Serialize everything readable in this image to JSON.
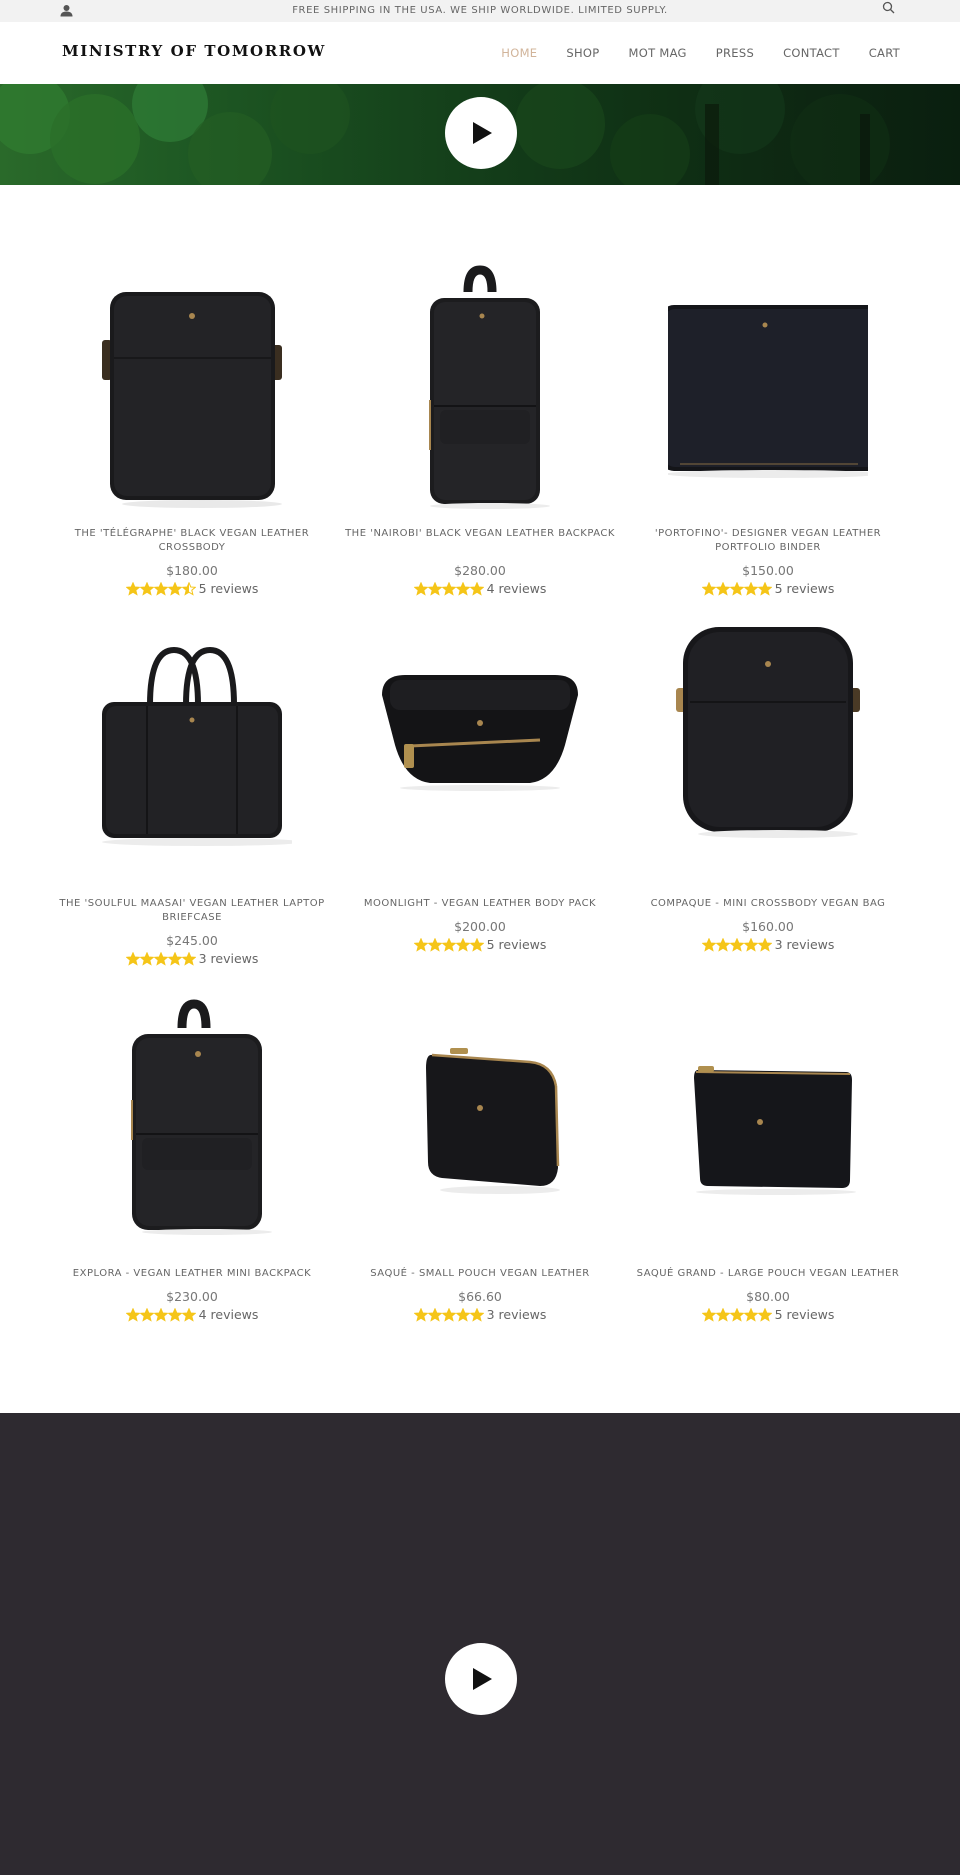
{
  "announcement": {
    "text": "FREE SHIPPING IN THE USA. WE SHIP WORLDWIDE. LIMITED SUPPLY.",
    "account_icon": "user-icon",
    "search_icon": "search-icon"
  },
  "header": {
    "logo": "MINISTRY OF TOMORROW",
    "nav": [
      {
        "label": "HOME",
        "active": true
      },
      {
        "label": "SHOP",
        "active": false
      },
      {
        "label": "MOT MAG",
        "active": false
      },
      {
        "label": "PRESS",
        "active": false
      },
      {
        "label": "CONTACT",
        "active": false
      },
      {
        "label": "CART",
        "active": false
      }
    ],
    "active_color": "#d1b49a"
  },
  "hero": {
    "play_icon": "play-icon"
  },
  "products": [
    {
      "title": "THE 'TÉLÉGRAPHE' BLACK VEGAN LEATHER CROSSBODY",
      "price": "$180.00",
      "rating": 4.5,
      "reviews": "5 reviews",
      "image": "crossbody-bag"
    },
    {
      "title": "THE 'NAIROBI' BLACK VEGAN LEATHER BACKPACK",
      "price": "$280.00",
      "rating": 5,
      "reviews": "4 reviews",
      "image": "backpack"
    },
    {
      "title": "'PORTOFINO'- DESIGNER VEGAN LEATHER PORTFOLIO BINDER",
      "price": "$150.00",
      "rating": 5,
      "reviews": "5 reviews",
      "image": "portfolio"
    },
    {
      "title": "THE 'SOULFUL MAASAI' VEGAN LEATHER LAPTOP BRIEFCASE",
      "price": "$245.00",
      "rating": 5,
      "reviews": "3 reviews",
      "image": "briefcase"
    },
    {
      "title": "MOONLIGHT - VEGAN LEATHER BODY PACK",
      "price": "$200.00",
      "rating": 5,
      "reviews": "5 reviews",
      "image": "body-pack"
    },
    {
      "title": "COMPAQUE - MINI CROSSBODY VEGAN BAG",
      "price": "$160.00",
      "rating": 5,
      "reviews": "3 reviews",
      "image": "mini-crossbody"
    },
    {
      "title": "EXPLORA - VEGAN LEATHER MINI BACKPACK",
      "price": "$230.00",
      "rating": 5,
      "reviews": "4 reviews",
      "image": "mini-backpack"
    },
    {
      "title": "SAQUÉ - SMALL POUCH VEGAN LEATHER",
      "price": "$66.60",
      "rating": 5,
      "reviews": "3 reviews",
      "image": "small-pouch"
    },
    {
      "title": "SAQUÉ GRAND - LARGE POUCH VEGAN LEATHER",
      "price": "$80.00",
      "rating": 5,
      "reviews": "5 reviews",
      "image": "large-pouch"
    }
  ],
  "colors": {
    "star": "#f5c518",
    "dark_section": "#2e2a30"
  }
}
